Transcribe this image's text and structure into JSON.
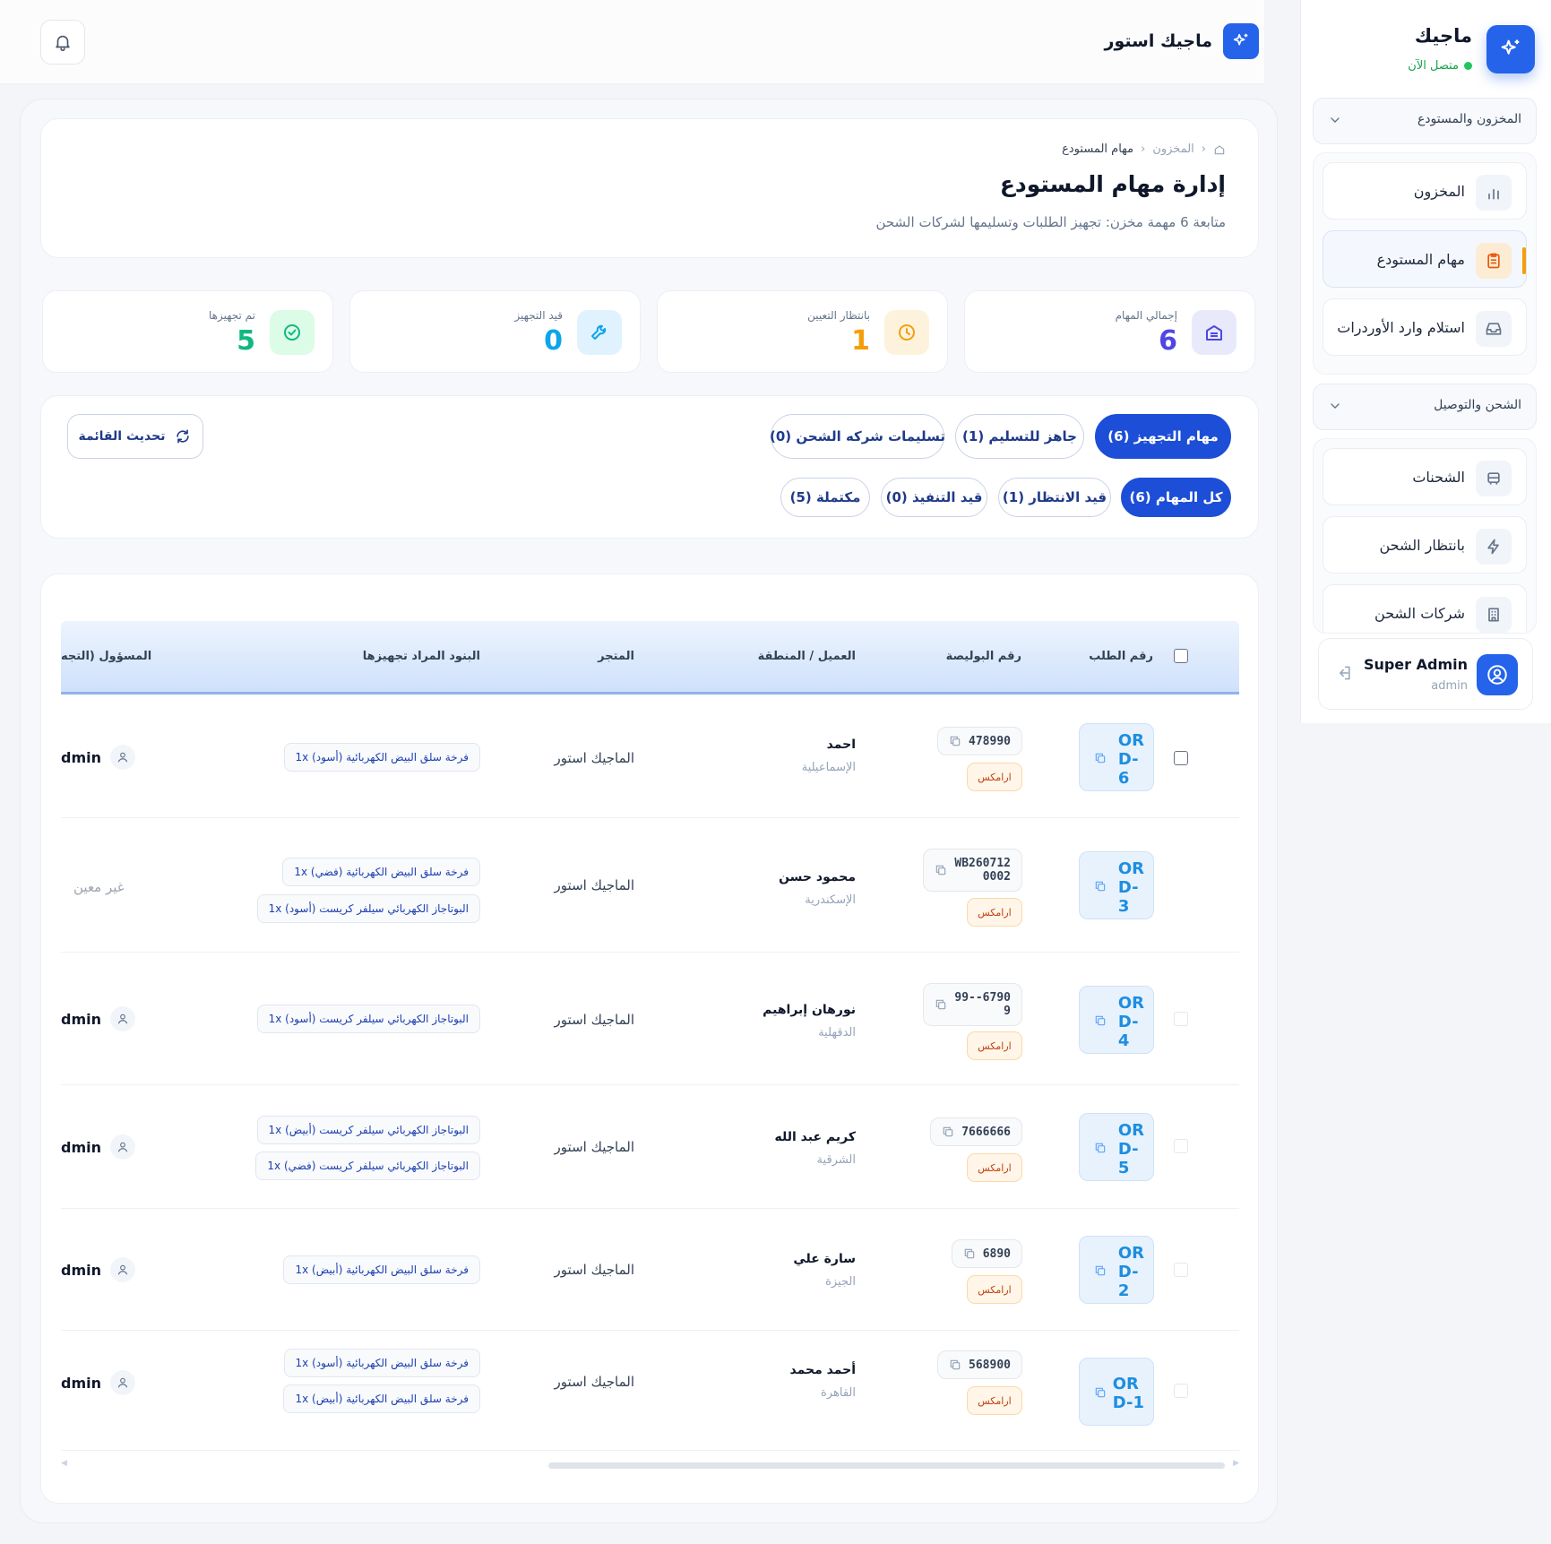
{
  "topbar": {
    "store_name": "ماجيك استور"
  },
  "sidebar": {
    "app_name": "ماجيك",
    "status": "متصل الآن",
    "sections": [
      {
        "label": "المخزون والمستودع",
        "items": [
          {
            "label": "المخزون",
            "icon": "bar-chart-icon"
          },
          {
            "label": "مهام المستودع",
            "icon": "clipboard-icon",
            "active": true
          },
          {
            "label": "استلام وارد الأوردرات",
            "icon": "inbox-icon"
          }
        ]
      },
      {
        "label": "الشحن والتوصيل",
        "items": [
          {
            "label": "الشحنات",
            "icon": "truck-icon"
          },
          {
            "label": "بانتظار الشحن",
            "icon": "lightning-icon"
          },
          {
            "label": "شركات الشحن",
            "icon": "building-icon"
          }
        ]
      }
    ],
    "user": {
      "name": "Super Admin",
      "role": "admin"
    }
  },
  "header": {
    "breadcrumb": [
      "المخزون",
      "مهام المستودع"
    ],
    "title": "إدارة مهام المستودع",
    "subtitle": "متابعة 6 مهمة مخزن: تجهيز الطلبات وتسليمها لشركات الشحن"
  },
  "stats": [
    {
      "label": "إجمالي المهام",
      "value": "6",
      "color": "#4f46e5"
    },
    {
      "label": "بانتظار التعيين",
      "value": "1",
      "color": "#f59e0b"
    },
    {
      "label": "قيد التجهيز",
      "value": "0",
      "color": "#0ea5e9"
    },
    {
      "label": "تم تجهيزها",
      "value": "5",
      "color": "#10b981"
    }
  ],
  "tabs_main": [
    "مهام التجهيز (6)",
    "جاهز للتسليم (1)",
    "تسليمات شركه الشحن (0)"
  ],
  "tabs_status": [
    "كل المهام (6)",
    "قيد الانتظار (1)",
    "قيد التنفيذ (0)",
    "مكتملة (5)"
  ],
  "refresh_label": "تحديث القائمة",
  "table": {
    "columns": [
      "رقم الطلب",
      "رقم البوليصة",
      "العميل / المنطقة",
      "المتجر",
      "البنود المراد تجهيزها",
      "المسؤول (التجه"
    ],
    "rows": [
      {
        "order": "OR\nD-\n6",
        "awb": "478990",
        "courier": "ارامكس",
        "customer": "احمد",
        "region": "الإسماعيلية",
        "store": "الماجيك استور",
        "items": [
          "فرخة سلق البيض الكهربائية (أسود) 1x"
        ],
        "owner": "dmin"
      },
      {
        "order": "OR\nD-\n3",
        "awb": "WB260712\n0002",
        "courier": "ارامكس",
        "customer": "محمود حسن",
        "region": "الإسكندرية",
        "store": "الماجيك استور",
        "items": [
          "فرخة سلق البيض الكهربائية (فضي) 1x",
          "البوتاجاز الكهربائي سيلفر كريست (أسود) 1x"
        ],
        "owner": "",
        "unassigned": "غير معين"
      },
      {
        "order": "OR\nD-\n4",
        "awb": "99--6790\n9",
        "courier": "ارامكس",
        "customer": "نورهان إبراهيم",
        "region": "الدقهلية",
        "store": "الماجيك استور",
        "items": [
          "البوتاجاز الكهربائي سيلفر كريست (أسود) 1x"
        ],
        "owner": "dmin"
      },
      {
        "order": "OR\nD-\n5",
        "awb": "7666666",
        "courier": "ارامكس",
        "customer": "كريم عبد الله",
        "region": "الشرقية",
        "store": "الماجيك استور",
        "items": [
          "البوتاجاز الكهربائي سيلفر كريست (أبيض) 1x",
          "البوتاجاز الكهربائي سيلفر كريست (فضي) 1x"
        ],
        "owner": "dmin"
      },
      {
        "order": "OR\nD-\n2",
        "awb": "6890",
        "courier": "ارامكس",
        "customer": "سارة علي",
        "region": "الجيزة",
        "store": "الماجيك استور",
        "items": [
          "فرخة سلق البيض الكهربائية (أبيض) 1x"
        ],
        "owner": "dmin"
      },
      {
        "order": "OR\nD-1",
        "awb": "568900",
        "courier": "ارامكس",
        "customer": "أحمد محمد",
        "region": "القاهرة",
        "store": "الماجيك استور",
        "items": [
          "فرخة سلق البيض الكهربائية (أسود) 1x",
          "فرخة سلق البيض الكهربائية (أبيض) 1x"
        ],
        "owner": "dmin"
      }
    ]
  }
}
